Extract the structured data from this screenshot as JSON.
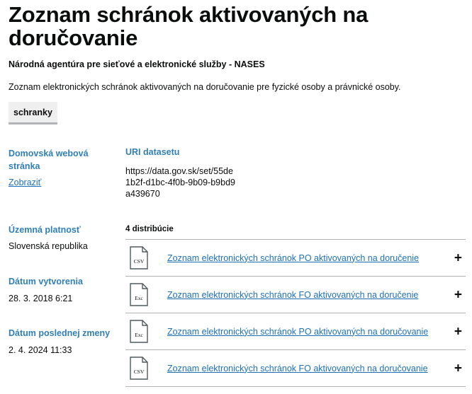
{
  "dataset": {
    "title": "Zoznam schránok aktivovaných na doručovanie",
    "publisher": "Národná agentúra pre sieťové a elektronické služby - NASES",
    "description": "Zoznam elektronických schránok aktivovaných na doručovanie pre fyzické osoby a právnické osoby.",
    "tag": "schranky"
  },
  "meta": {
    "homepage_label": "Domovská webová stránka",
    "homepage_link": "Zobraziť",
    "validity_label": "Územná platnosť",
    "validity_value": "Slovenská republika",
    "created_label": "Dátum vytvorenia",
    "created_value": "28. 3. 2018 6:21",
    "modified_label": "Dátum poslednej zmeny",
    "modified_value": "2. 4. 2024 11:33"
  },
  "uri": {
    "label": "URI datasetu",
    "value": "https://data.gov.sk/set/55de1b2f-d1bc-4f0b-9b09-b9bd9a439670"
  },
  "distributions": {
    "count_label": "4 distribúcie",
    "items": [
      {
        "format": "CSV",
        "title": "Zoznam elektronických schránok PO aktivovaných na doručenie",
        "expand": "+"
      },
      {
        "format": "Exc",
        "title": "Zoznam elektronických schránok FO aktivovaných na doručenie",
        "expand": "+"
      },
      {
        "format": "Exc",
        "title": "Zoznam elektronických schránok PO aktivovaných na doručovanie",
        "expand": "+"
      },
      {
        "format": "CSV",
        "title": "Zoznam elektronických schránok FO aktivovaných na doručovanie",
        "expand": "+"
      }
    ]
  }
}
